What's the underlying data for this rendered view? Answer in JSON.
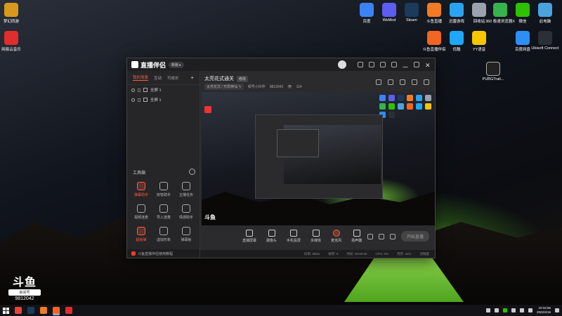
{
  "desktop": {
    "left_icons": [
      {
        "label": "梦幻西游",
        "icon": "menghuan-xiyou-icon",
        "color": "#d79a1c"
      },
      {
        "label": "网易云音乐",
        "icon": "netease-music-icon",
        "color": "#e02d2d"
      }
    ],
    "top_icons": [
      {
        "label": "百度",
        "icon": "baidu-app-icon",
        "color": "#3b83f5"
      },
      {
        "label": "WeMod",
        "icon": "wemod-icon",
        "color": "#5b5ef0"
      },
      {
        "label": "Steam",
        "icon": "steam-icon",
        "color": "#1b3a5c"
      },
      {
        "label": "斗鱼直播",
        "icon": "douyu-live-icon",
        "color": "#f37b24"
      },
      {
        "label": "迅雷游戏",
        "icon": "xunlei-game-icon",
        "color": "#2aa3ef"
      },
      {
        "label": "回收站",
        "icon": "recycle-bin-icon",
        "color": "#9aa3ad"
      },
      {
        "label": "360 极速浏览器X",
        "icon": "360-browser-icon",
        "color": "#37b24d"
      },
      {
        "label": "微信",
        "icon": "wechat-icon",
        "color": "#2dc100"
      },
      {
        "label": "此电脑",
        "icon": "this-pc-icon",
        "color": "#4aa3df"
      }
    ],
    "row2_icons": [
      {
        "label": "斗鱼直播伴侣",
        "icon": "douyu-companion-icon",
        "color": "#f26522"
      },
      {
        "label": "优酷",
        "icon": "youku-icon",
        "color": "#1ea7fd"
      },
      {
        "label": "YY语音",
        "icon": "yy-voice-icon",
        "color": "#f7c600"
      },
      {
        "label": "百度网盘",
        "icon": "baidu-netdisk-icon",
        "color": "#2f8ef5"
      },
      {
        "label": "Ubisoft Connect",
        "icon": "ubisoft-icon",
        "color": "#2b2f36"
      }
    ],
    "pubg_label": "PUBGTrail...",
    "douyu_badge": {
      "brand": "斗鱼",
      "label": "房间号",
      "room_id": "9812042"
    }
  },
  "app": {
    "title": "直播伴侣",
    "version_badge": "新版 ▸",
    "scene_tabs": [
      "我的场景",
      "互动",
      "可成长"
    ],
    "scenes": [
      {
        "label": "全屏 1"
      },
      {
        "label": "全屏 1"
      }
    ],
    "toolbox_title": "工具箱",
    "tools": [
      {
        "label": "弹幕助手",
        "hot": true
      },
      {
        "label": "房管助手",
        "hot": false
      },
      {
        "label": "主播任务",
        "hot": false
      },
      {
        "label": "视频连麦",
        "hot": false
      },
      {
        "label": "导入连麦",
        "hot": false
      },
      {
        "label": "情感助手",
        "hot": false
      },
      {
        "label": "超级弹",
        "hot": true
      },
      {
        "label": "虚拟形象",
        "hot": false
      },
      {
        "label": "弹幕板",
        "hot": false
      },
      {
        "label": "",
        "hot": false
      },
      {
        "label": "",
        "hot": false
      },
      {
        "label": "",
        "hot": false
      }
    ],
    "left_footer": "斗鱼直播伴侣使用教程",
    "room_title": "太亮花式通关",
    "room_tag": "修改",
    "room_category": "太亮花式 / 开局神仙 ✎",
    "room_id_label": "频号小伙伴",
    "room_id": "9812042",
    "viewers": "114",
    "actions": [
      {
        "label": "直播屏幕",
        "name": "screen-capture-button",
        "mic": false
      },
      {
        "label": "摄像头",
        "name": "camera-button",
        "mic": false
      },
      {
        "label": "手机投屏",
        "name": "phone-cast-button",
        "mic": false
      },
      {
        "label": "多媒体",
        "name": "media-button",
        "mic": false
      },
      {
        "label": "麦克风",
        "name": "microphone-button",
        "mic": true
      },
      {
        "label": "扬声器",
        "name": "speaker-button",
        "mic": false
      }
    ],
    "go_live_label": "开始直播",
    "status": [
      "码率: 0kb/s",
      "帧率: 0",
      "时间: 00:00:00",
      "CPU: 0%",
      "内存: 42%",
      "流畅度"
    ]
  },
  "taskbar": {
    "apps": [
      {
        "icon": "chrome-icon",
        "color": "#e8453c"
      },
      {
        "icon": "steam-taskbar-icon",
        "color": "#1b3a5c"
      },
      {
        "icon": "douyu-taskbar-icon",
        "color": "#f37b24"
      },
      {
        "icon": "companion-taskbar-icon",
        "color": "#f26522"
      },
      {
        "icon": "netease-taskbar-icon",
        "color": "#e02d2d"
      }
    ],
    "time": "10:34:56",
    "date": "2022/4/16"
  }
}
